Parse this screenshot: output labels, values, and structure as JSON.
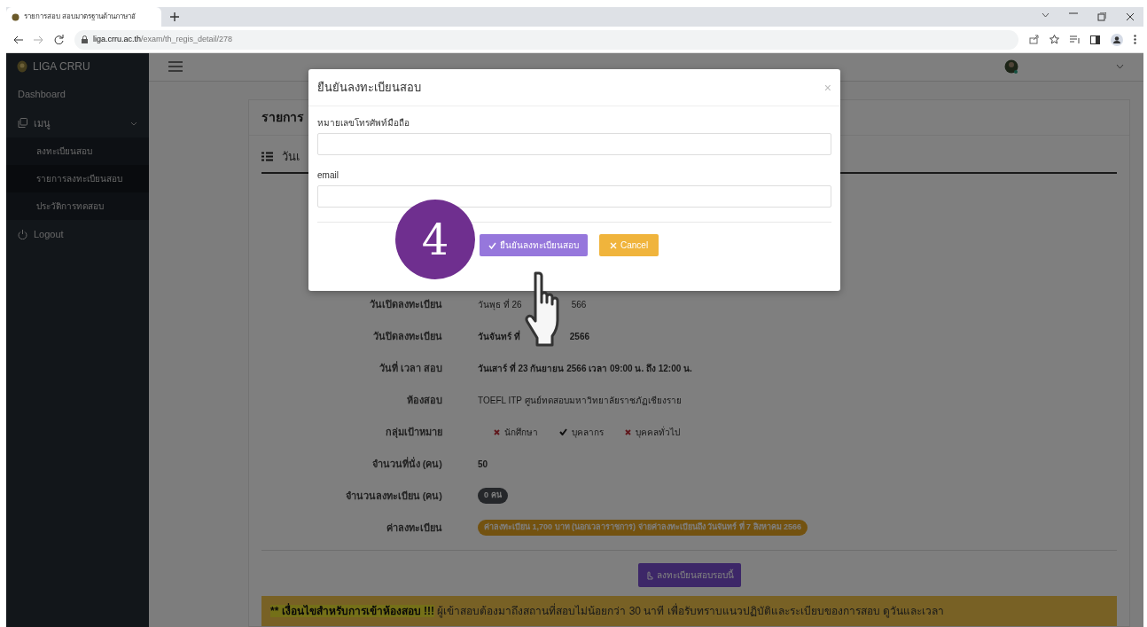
{
  "browser": {
    "tab_title": "รายการสอบ สอบมาตรฐานด้านภาษาอั",
    "url_host": "liga.crru.ac.th",
    "url_path": "/exam/th_regis_detail/278"
  },
  "sidebar": {
    "brand": "LIGA CRRU",
    "items": [
      {
        "kind": "link",
        "label": "Dashboard",
        "selected": false
      },
      {
        "kind": "group",
        "label": "เมนู",
        "expanded": true,
        "children": [
          {
            "label": "ลงทะเบียนสอบ",
            "selected": false
          },
          {
            "label": "รายการลงทะเบียนสอบ",
            "selected": true
          },
          {
            "label": "ประวัติการทดสอบ",
            "selected": false
          }
        ]
      },
      {
        "kind": "logout",
        "label": "Logout",
        "selected": false
      }
    ]
  },
  "card": {
    "title": "รายการ",
    "section_title": "วันเ",
    "rows": [
      {
        "kind": "split",
        "label": "วันเปิดลงทะเบียน",
        "parts": [
          "วันพุธ ที่ 26",
          "566"
        ],
        "bold": false
      },
      {
        "kind": "split",
        "label": "วันปิดลงทะเบียน",
        "parts": [
          "วันจันทร์ ที่",
          "2566"
        ],
        "bold": true
      },
      {
        "kind": "text",
        "label": "วันที่ เวลา สอบ",
        "value": "วันเสาร์ ที่ 23 กันยายน 2566 เวลา 09:00 น. ถึง 12:00 น.",
        "bold": true
      },
      {
        "kind": "text",
        "label": "ห้องสอบ",
        "value": "TOEFL ITP ศูนย์ทดสอบมหาวิทยาลัยราชภัฏเชียงราย",
        "bold": false
      },
      {
        "kind": "targets",
        "label": "กลุ่มเป้าหมาย",
        "targets": [
          {
            "label": "นักศึกษา",
            "checked": false
          },
          {
            "label": "บุคลากร",
            "checked": true
          },
          {
            "label": "บุคคลทั่วไป",
            "checked": false
          }
        ]
      },
      {
        "kind": "text",
        "label": "จำนวนที่นั่ง (คน)",
        "value": "50",
        "bold": true
      },
      {
        "kind": "badge",
        "label": "จำนวนลงทะเบียน (คน)",
        "value": "0 คน"
      },
      {
        "kind": "fee",
        "label": "ค่าลงทะเบียน",
        "value": "ค่าลงทะเบียน 1,700 บาท (นอกเวลาราชการ) จ่ายค่าลงทะเบียนถึง วันจันทร์ ที่ 7 สิงหาคม 2566"
      }
    ],
    "register_button": "ลงทะเบียนสอบรอบนี้",
    "alert": {
      "title": "** เงื่อนไขสำหรับการเข้าห้องสอบ !!!",
      "text": "ผู้เข้าสอบต้องมาถึงสถานที่สอบไม่น้อยกว่า 30 นาที เพื่อรับทราบแนวปฏิบัติและระเบียบของการสอบ ดูวันและเวลา"
    }
  },
  "modal": {
    "title": "ยืนยันลงทะเบียนสอบ",
    "close": "×",
    "fields": [
      {
        "label": "หมายเลขโทรศัพท์มือถือ"
      },
      {
        "label": "email"
      }
    ],
    "confirm_button": "ยืนยันลงทะเบียนสอบ",
    "cancel_button": "Cancel"
  },
  "step_marker": "4"
}
